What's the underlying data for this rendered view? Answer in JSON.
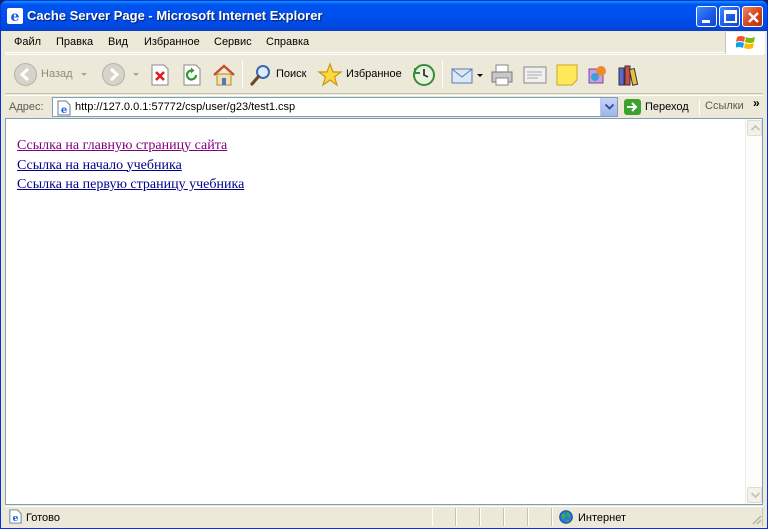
{
  "window": {
    "title": "Cache Server Page - Microsoft Internet Explorer"
  },
  "menu": {
    "items": [
      "Файл",
      "Правка",
      "Вид",
      "Избранное",
      "Сервис",
      "Справка"
    ]
  },
  "toolbar": {
    "back_label": "Назад",
    "search_label": "Поиск",
    "favorites_label": "Избранное"
  },
  "address": {
    "label": "Адрес:",
    "url": "http://127.0.0.1:57772/csp/user/g23/test1.csp",
    "go_label": "Переход",
    "links_label": "Ссылки",
    "links_chevron": "»"
  },
  "page": {
    "links": [
      {
        "text": "Ссылка на главную страницу сайта",
        "visited": true
      },
      {
        "text": "Ссылка на начало учебника",
        "visited": false
      },
      {
        "text": "Ссылка на первую страницу учебника",
        "visited": false
      }
    ]
  },
  "status": {
    "text": "Готово",
    "zone": "Интернет"
  },
  "colors": {
    "visited_link": "#800080",
    "unvisited_link": "#00008b",
    "titlebar": "#0053ee"
  }
}
